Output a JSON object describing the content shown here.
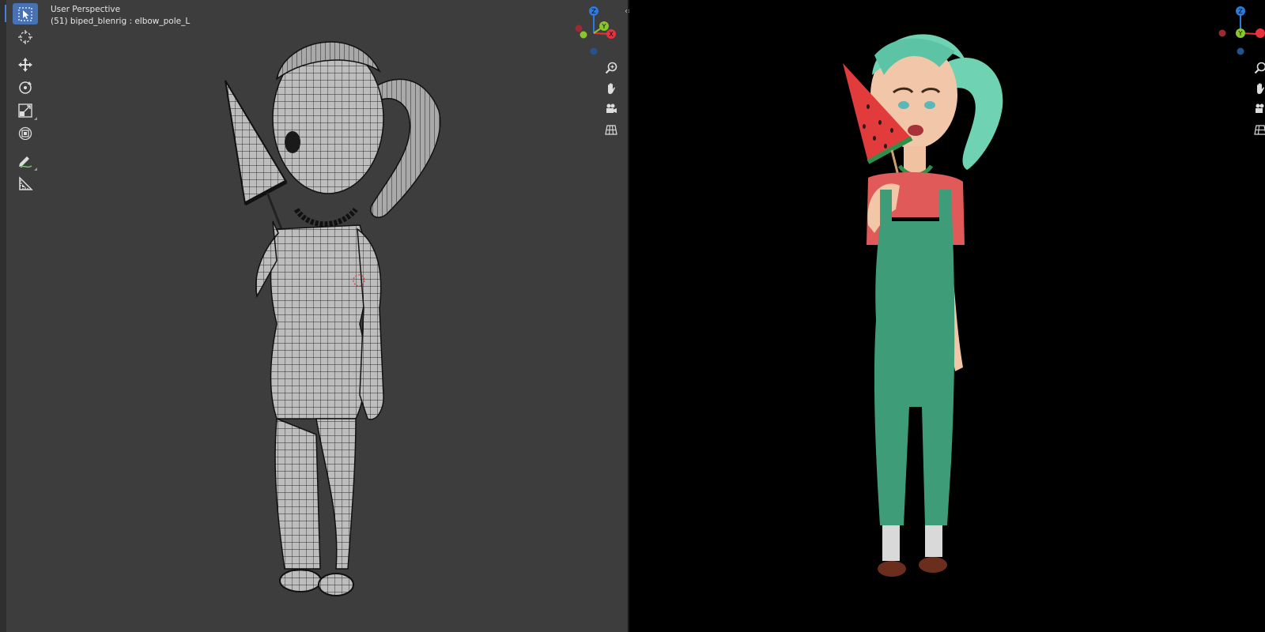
{
  "header": {
    "mode": "User Perspective",
    "active_object": "(51) biped_blenrig : elbow_pole_L"
  },
  "toolbar": {
    "tools": [
      {
        "name": "select-box",
        "active": true
      },
      {
        "name": "cursor",
        "active": false
      },
      {
        "name": "move",
        "active": false
      },
      {
        "name": "rotate",
        "active": false
      },
      {
        "name": "scale",
        "active": false
      },
      {
        "name": "transform",
        "active": false
      },
      {
        "name": "annotate",
        "active": false
      },
      {
        "name": "measure",
        "active": false
      }
    ]
  },
  "gizmo": {
    "axes": {
      "x": "X",
      "y": "Y",
      "z": "Z"
    },
    "colors": {
      "x": "#e8313f",
      "y": "#8ac52a",
      "z": "#2a7bde",
      "neg_x": "#9b2a33",
      "neg_y": "#56801c",
      "neg_z": "#23528f"
    }
  },
  "navigation": [
    "zoom-icon",
    "hand-pan-icon",
    "camera-icon",
    "grid-icon"
  ],
  "split_handle": "‹›",
  "colors": {
    "viewport_left": "#3d3d3d",
    "viewport_right": "#000000",
    "accent": "#4772b3",
    "hair": "#6fd3b3",
    "overalls": "#3f9c78",
    "shirt": "#e05a5a",
    "watermelon": "#e23b3b"
  }
}
